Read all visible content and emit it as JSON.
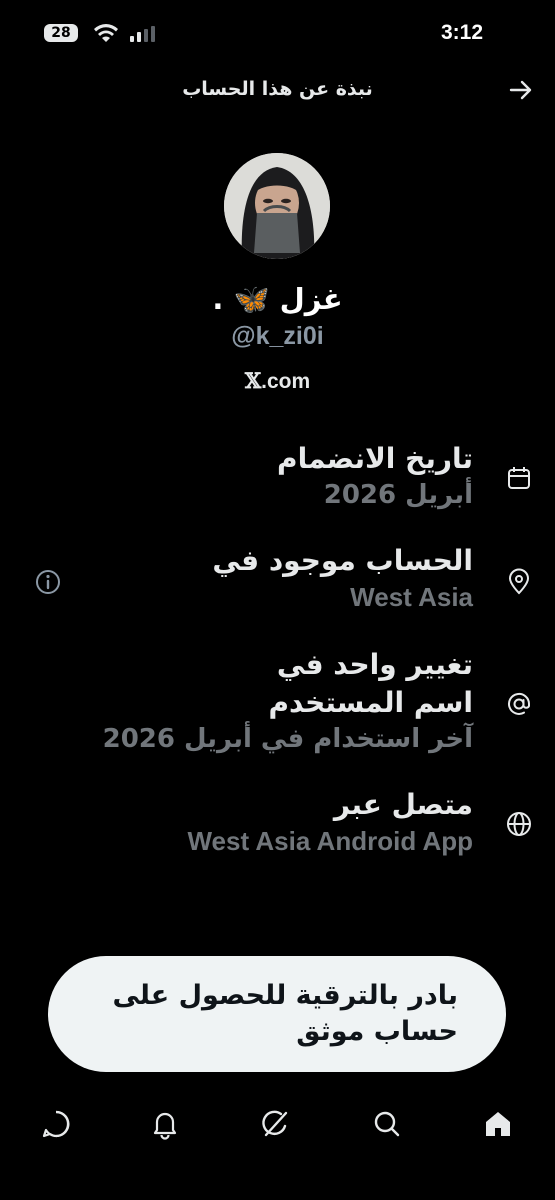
{
  "status_bar": {
    "time": "3:12",
    "battery_level": "28",
    "icons": [
      "battery-icon",
      "wifi-icon",
      "signal-icon"
    ]
  },
  "header": {
    "title": "نبذة عن هذا الحساب",
    "back_icon": "arrow-right-icon"
  },
  "profile": {
    "display_name": "غزل 🦋 .",
    "handle": "@k_zi0i",
    "domain_x": "𝕏",
    "domain_text": ".com"
  },
  "info": [
    {
      "icon": "calendar-icon",
      "title": "تاريخ الانضمام",
      "subtitle": "أبريل 2026"
    },
    {
      "icon": "location-pin-icon",
      "title": "الحساب موجود في",
      "subtitle": "West Asia",
      "side_icon": "info-circle-icon"
    },
    {
      "icon": "at-sign-icon",
      "title_line1": "تغيير واحد في",
      "title_line2": "اسم المستخدم",
      "subtitle": "آخر استخدام في أبريل 2026"
    },
    {
      "icon": "globe-icon",
      "title": "متصل عبر",
      "subtitle": "West Asia Android App"
    }
  ],
  "upgrade_banner": {
    "line1": "بادر بالترقية للحصول على",
    "line2": "حساب موثق"
  },
  "bottom_nav": [
    "chat-icon",
    "bell-icon",
    "grok-icon",
    "search-icon",
    "home-icon"
  ],
  "colors": {
    "background": "#000000",
    "text": "#e7e9ea",
    "muted": "#71767b",
    "banner": "#eff3f4"
  }
}
